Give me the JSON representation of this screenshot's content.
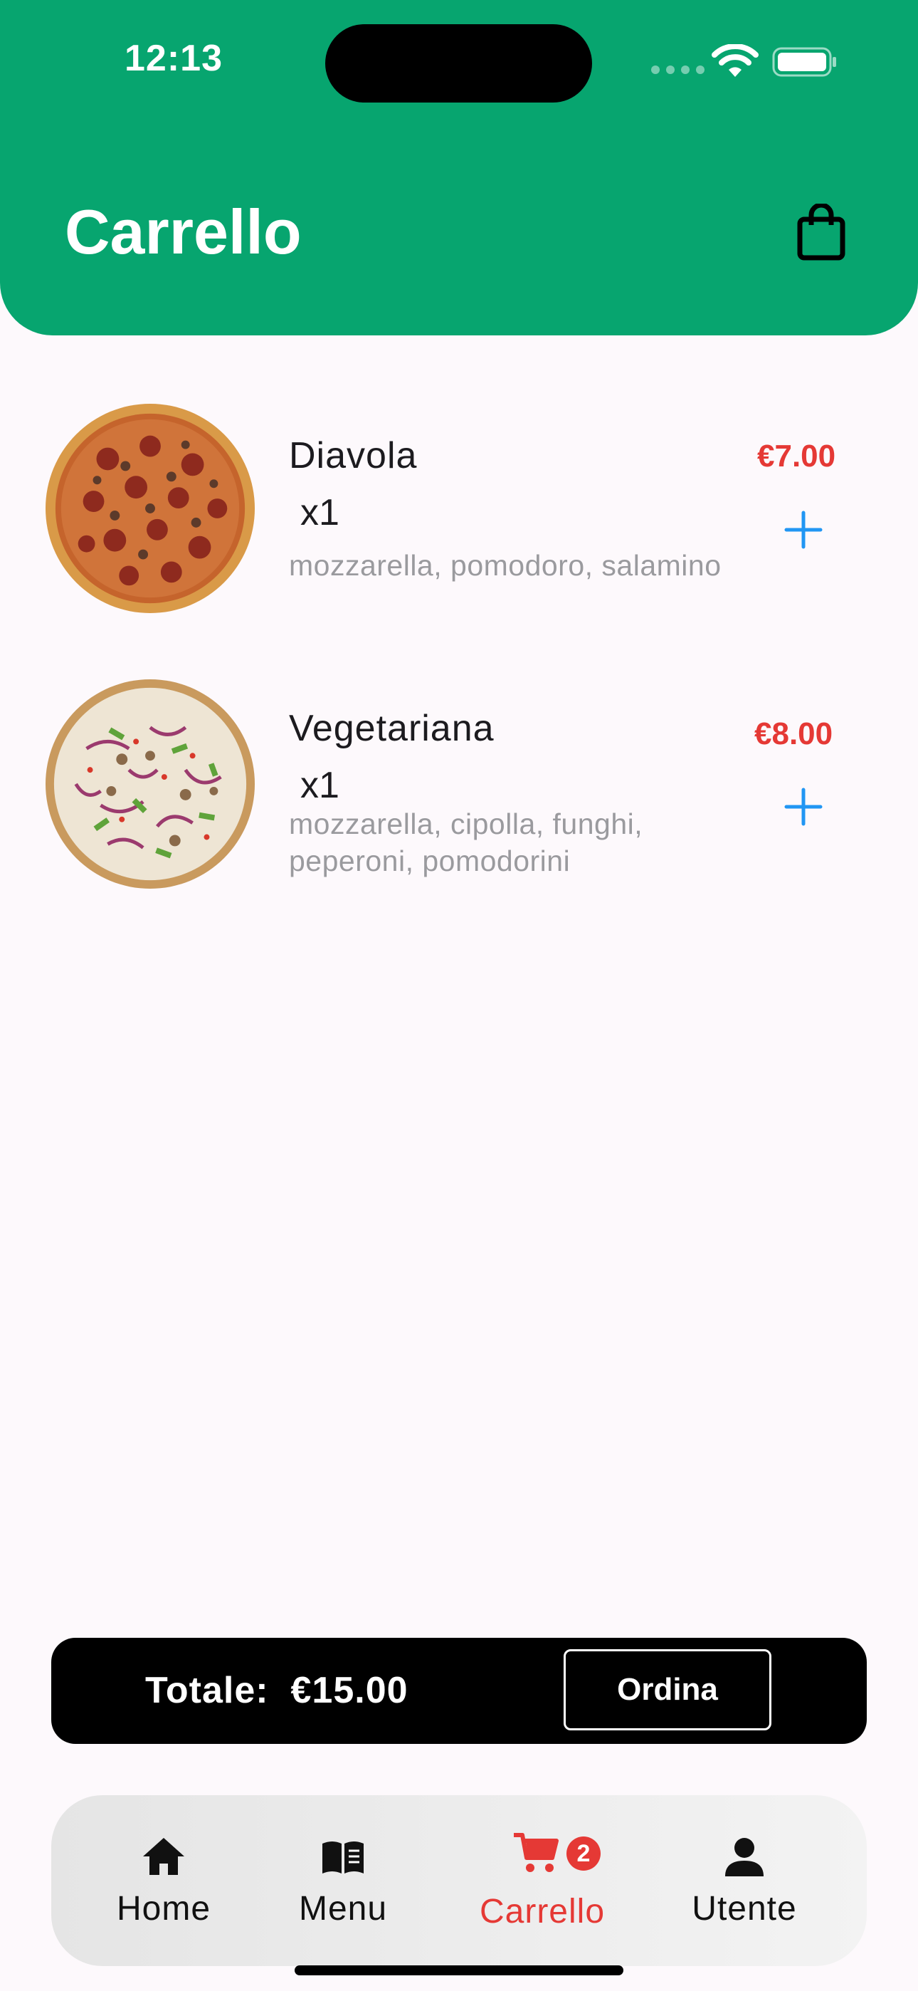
{
  "status_bar": {
    "time": "12:13"
  },
  "header": {
    "title": "Carrello",
    "icon": "shopping-bag-icon"
  },
  "cart": {
    "items": [
      {
        "name": "Diavola",
        "qty": "x1",
        "ingredients": "mozzarella, pomodoro, salamino",
        "price": "€7.00"
      },
      {
        "name": "Vegetariana",
        "qty": "x1",
        "ingredients": "mozzarella, cipolla, funghi, peperoni, pomodorini",
        "price": "€8.00"
      }
    ]
  },
  "total": {
    "label": "Totale:  €15.00",
    "order_label": "Ordina"
  },
  "tabs": [
    {
      "label": "Home",
      "icon": "home-icon"
    },
    {
      "label": "Menu",
      "icon": "menu-book-icon"
    },
    {
      "label": "Carrello",
      "icon": "cart-icon",
      "badge": "2",
      "active": true
    },
    {
      "label": "Utente",
      "icon": "user-icon"
    }
  ],
  "colors": {
    "header": "#07a56f",
    "accent": "#e53935",
    "plus": "#2196f3"
  }
}
